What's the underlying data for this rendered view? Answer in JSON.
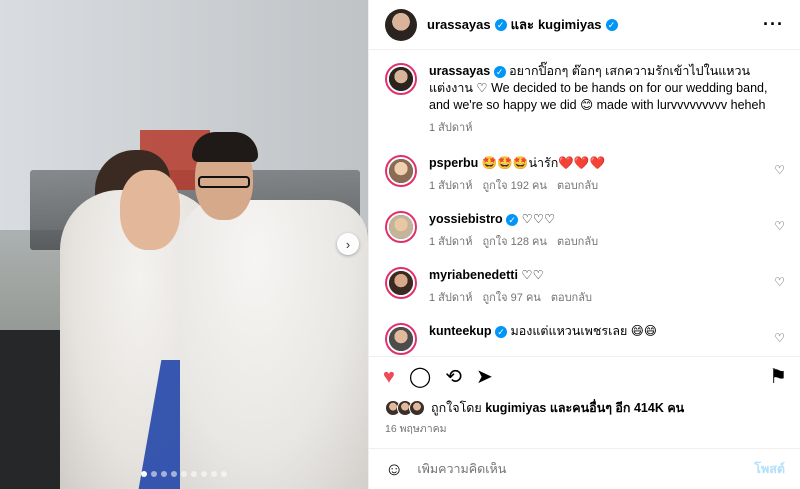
{
  "header": {
    "user1": "urassayas",
    "and": "และ",
    "user2": "kugimiyas",
    "more_icon": "more-horizontal-icon"
  },
  "caption": {
    "username": "urassayas",
    "text": "อยากปิ๊อกๆ ต๊อกๆ เสกความรักเข้าไปในแหวนแต่งงาน ♡ We decided to be hands on for our wedding band, and we're so happy we did 😊 made with lurvvvvvvvvv heheh",
    "time": "1 สัปดาห์"
  },
  "comments": [
    {
      "username": "psperbu",
      "verified": false,
      "text": "🤩🤩🤩น่ารัก❤️❤️❤️",
      "time": "1 สัปดาห์",
      "likes": "ถูกใจ 192 คน",
      "reply": "ตอบกลับ"
    },
    {
      "username": "yossiebistro",
      "verified": true,
      "text": "♡♡♡",
      "time": "1 สัปดาห์",
      "likes": "ถูกใจ 128 คน",
      "reply": "ตอบกลับ"
    },
    {
      "username": "myriabenedetti",
      "verified": false,
      "text": "♡♡",
      "time": "1 สัปดาห์",
      "likes": "ถูกใจ 97 คน",
      "reply": "ตอบกลับ"
    },
    {
      "username": "kunteekup",
      "verified": true,
      "text": "มองแต่แหวนเพชรเลย 😄😄",
      "time": "",
      "likes": "",
      "reply": ""
    }
  ],
  "likes": {
    "prefix": "ถูกใจโดย",
    "user": "kugimiyas",
    "suffix": "และคนอื่นๆ อีก 414K คน"
  },
  "date": "16 พฤษภาคม",
  "add_comment": {
    "placeholder": "เพิ่มความคิดเห็น",
    "post_label": "โพสต์"
  },
  "photo": {
    "carousel_count": 9,
    "active_index": 0
  },
  "colors": {
    "verified": "#0095f6",
    "liked_heart": "#ed4956",
    "post_button": "#b2dffc"
  }
}
